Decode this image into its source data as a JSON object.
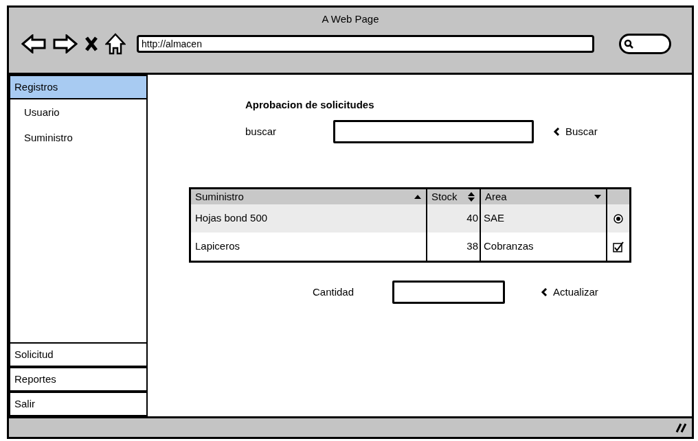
{
  "window": {
    "title": "A Web Page"
  },
  "browser": {
    "url": "http://almacen"
  },
  "sidebar": {
    "sections": [
      {
        "label": "Registros",
        "selected": true,
        "children": [
          {
            "label": "Usuario"
          },
          {
            "label": "Suministro"
          }
        ]
      },
      {
        "label": "Solicitud",
        "selected": false
      },
      {
        "label": "Reportes",
        "selected": false
      },
      {
        "label": "Salir",
        "selected": false
      }
    ]
  },
  "form": {
    "title": "Aprobacion de solicitudes",
    "search_label": "buscar",
    "search_button": "Buscar"
  },
  "table": {
    "columns": [
      {
        "label": "Suministro",
        "kind": "ascending"
      },
      {
        "label": "Stock",
        "kind": "sortable"
      },
      {
        "label": "Area",
        "kind": "descending"
      }
    ],
    "rows": [
      {
        "suministro": "Hojas bond 500",
        "stock": "40",
        "area": "SAE",
        "selected": true,
        "kind": "radio",
        "checked": true
      },
      {
        "suministro": "Lapiceros",
        "stock": "38",
        "area": "Cobranzas",
        "selected": false,
        "kind": "checkbox",
        "checked": true
      }
    ]
  },
  "update": {
    "label": "Cantidad",
    "button": "Actualizar"
  }
}
